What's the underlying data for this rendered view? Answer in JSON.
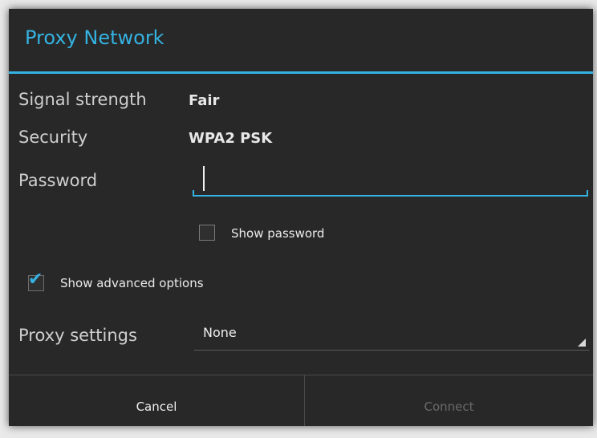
{
  "dialog": {
    "title": "Proxy Network",
    "signal_label": "Signal strength",
    "signal_value": "Fair",
    "security_label": "Security",
    "security_value": "WPA2 PSK",
    "password_label": "Password",
    "password_value": "",
    "show_password_label": "Show password",
    "show_password_checked": false,
    "advanced_label": "Show advanced options",
    "advanced_checked": true,
    "proxy_label": "Proxy settings",
    "proxy_value": "None",
    "cancel_label": "Cancel",
    "connect_label": "Connect",
    "connect_enabled": false
  },
  "colors": {
    "accent": "#35b2e1",
    "dialog_bg": "#282828",
    "disabled_text": "#6a6a6a"
  }
}
